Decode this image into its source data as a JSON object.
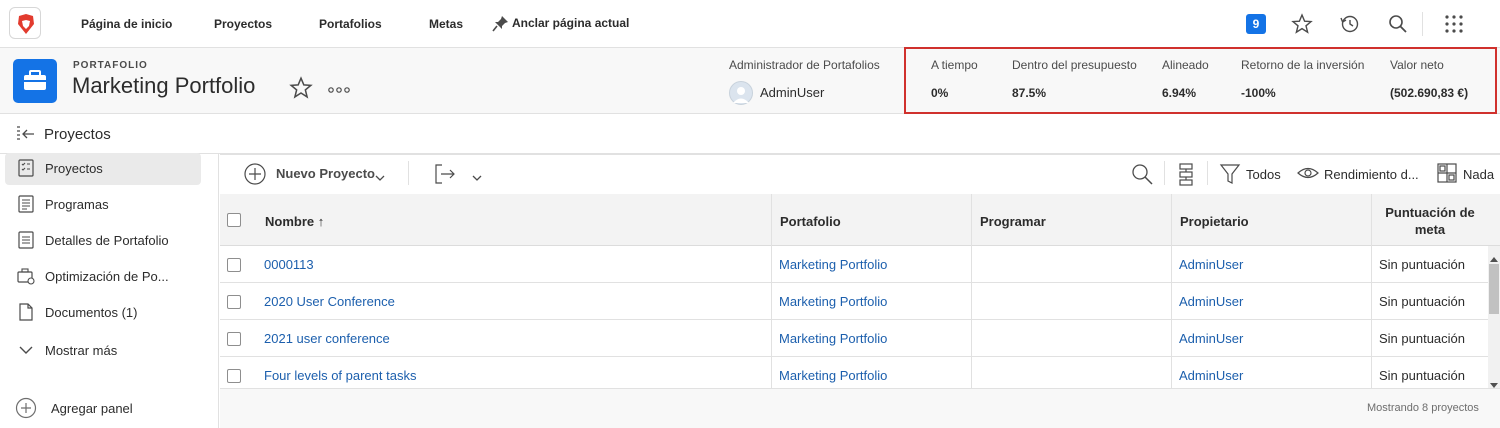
{
  "nav": {
    "items": [
      {
        "label": "Página de inicio"
      },
      {
        "label": "Proyectos"
      },
      {
        "label": "Portafolios"
      },
      {
        "label": "Metas"
      }
    ],
    "pin_label": "Anclar página actual",
    "notification_count": "9",
    "icons": [
      "app-logo-icon",
      "pin-icon",
      "star-icon",
      "history-icon",
      "search-icon",
      "apps-grid-icon"
    ]
  },
  "header": {
    "object_type": "PORTAFOLIO",
    "title": "Marketing Portfolio",
    "admin_label": "Administrador de Portafolios",
    "admin_name": "AdminUser",
    "kpis": [
      {
        "label": "A tiempo",
        "value": "0%"
      },
      {
        "label": "Dentro del presupuesto",
        "value": "87.5%"
      },
      {
        "label": "Alineado",
        "value": "6.94%"
      },
      {
        "label": "Retorno de la inversión",
        "value": "-100%"
      },
      {
        "label": "Valor neto",
        "value": "(502.690,83 €)"
      }
    ]
  },
  "sidebar": {
    "heading": "Proyectos",
    "items": [
      {
        "label": "Proyectos",
        "active": true
      },
      {
        "label": "Programas"
      },
      {
        "label": "Detalles de Portafolio"
      },
      {
        "label": "Optimización de Po..."
      },
      {
        "label": "Documentos (1)"
      },
      {
        "label": "Mostrar más"
      }
    ],
    "add_panel": "Agregar panel"
  },
  "toolbar": {
    "new_project": "Nuevo Proyecto",
    "filter": "Todos",
    "view": "Rendimiento d...",
    "grouping": "Nada"
  },
  "table": {
    "columns": [
      "Nombre ↑",
      "Portafolio",
      "Programar",
      "Propietario",
      "Puntuación de meta"
    ],
    "rows": [
      {
        "name": "0000113",
        "portfolio": "Marketing Portfolio",
        "program": "",
        "owner": "AdminUser",
        "score": "Sin puntuación"
      },
      {
        "name": "2020 User Conference",
        "portfolio": "Marketing Portfolio",
        "program": "",
        "owner": "AdminUser",
        "score": "Sin puntuación"
      },
      {
        "name": "2021 user conference",
        "portfolio": "Marketing Portfolio",
        "program": "",
        "owner": "AdminUser",
        "score": "Sin puntuación"
      },
      {
        "name": "Four levels of parent tasks",
        "portfolio": "Marketing Portfolio",
        "program": "",
        "owner": "AdminUser",
        "score": "Sin puntuación"
      }
    ]
  },
  "footer": {
    "count_text": "Mostrando 8 proyectos"
  },
  "colors": {
    "accent": "#1473e6",
    "link": "#1c5fad",
    "highlight_border": "#d0312d",
    "logo": "#e23b2e"
  }
}
